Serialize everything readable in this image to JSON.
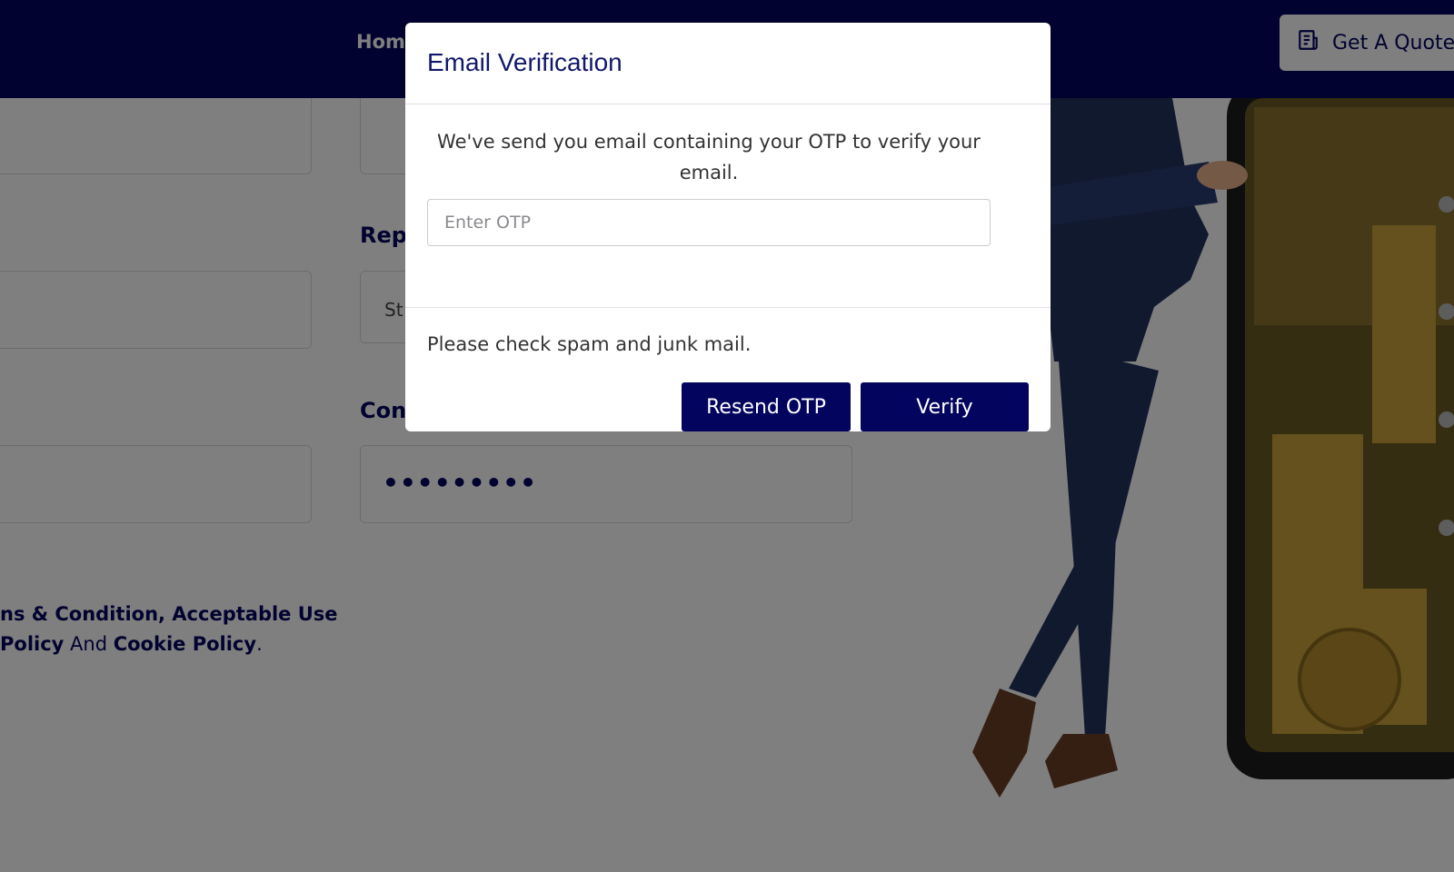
{
  "header": {
    "nav_home": "Hom",
    "quote_button": "Get A Quote"
  },
  "form": {
    "label_repeat": "Rep",
    "label_confirm": "Con",
    "select_partial": "St",
    "password_dots": "•••••••••"
  },
  "terms": {
    "line1_bold": "ns & Condition, Acceptable Use",
    "line2_bold_a": "Policy",
    "line2_and": " And ",
    "line2_bold_b": "Cookie Policy",
    "line2_end": "."
  },
  "modal": {
    "title": "Email Verification",
    "message": "We've send you email containing your OTP to verify your email.",
    "otp_placeholder": "Enter OTP",
    "spam_note": "Please check spam and junk mail.",
    "resend_label": "Resend OTP",
    "verify_label": "Verify"
  },
  "colors": {
    "brand_navy": "#03045e",
    "overlay": "rgba(0,0,0,0.5)"
  },
  "icons": {
    "quote": "receipt-icon"
  }
}
